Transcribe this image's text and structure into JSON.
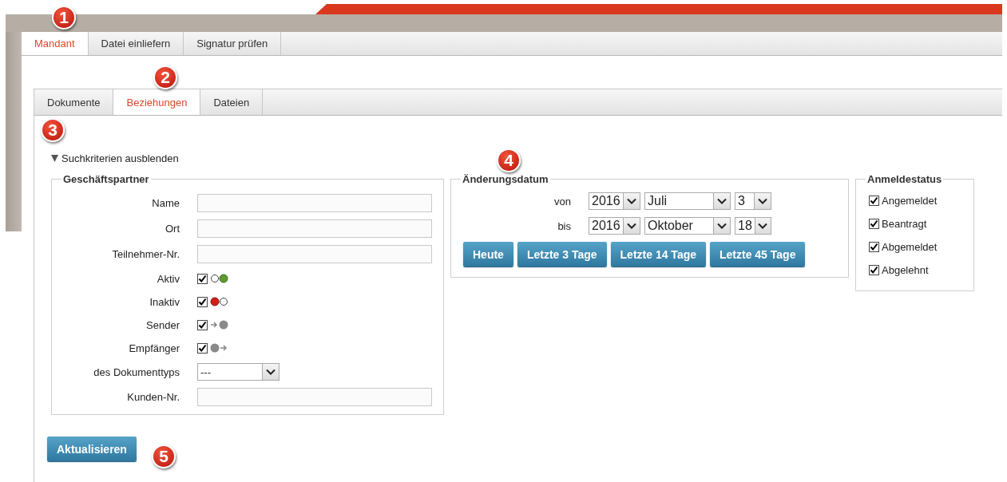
{
  "top_tabs": [
    {
      "label": "Mandant",
      "selected": true
    },
    {
      "label": "Datei einliefern",
      "selected": false
    },
    {
      "label": "Signatur prüfen",
      "selected": false
    }
  ],
  "sub_tabs": [
    {
      "label": "Dokumente",
      "selected": false
    },
    {
      "label": "Beziehungen",
      "selected": true
    },
    {
      "label": "Dateien",
      "selected": false
    }
  ],
  "toggle": {
    "label": "Suchkriterien ausblenden",
    "expanded": true
  },
  "partner": {
    "title": "Geschäftspartner",
    "fields": [
      {
        "kind": "text",
        "label": "Name"
      },
      {
        "kind": "text",
        "label": "Ort"
      },
      {
        "kind": "text",
        "label": "Teilnehmer-Nr."
      },
      {
        "kind": "active",
        "label": "Aktiv",
        "checked": true
      },
      {
        "kind": "inactive",
        "label": "Inaktiv",
        "checked": true
      },
      {
        "kind": "sender",
        "label": "Sender",
        "checked": true
      },
      {
        "kind": "receiver",
        "label": "Empfänger",
        "checked": true
      },
      {
        "kind": "select",
        "label": "des Dokumenttyps",
        "value": "---"
      },
      {
        "kind": "text",
        "label": "Kunden-Nr."
      }
    ]
  },
  "change_date": {
    "title": "Änderungsdatum",
    "rows": [
      {
        "label": "von",
        "year": "2016",
        "month": "Juli",
        "day": "3"
      },
      {
        "label": "bis",
        "year": "2016",
        "month": "Oktober",
        "day": "18"
      }
    ],
    "buttons": [
      "Heute",
      "Letzte 3 Tage",
      "Letzte 14 Tage",
      "Letzte 45 Tage"
    ]
  },
  "status": {
    "title": "Anmeldestatus",
    "items": [
      {
        "label": "Angemeldet",
        "checked": true
      },
      {
        "label": "Beantragt",
        "checked": true
      },
      {
        "label": "Abgemeldet",
        "checked": true
      },
      {
        "label": "Abgelehnt",
        "checked": true
      }
    ]
  },
  "submit": "Aktualisieren",
  "callouts": [
    "1",
    "2",
    "3",
    "4",
    "5"
  ]
}
